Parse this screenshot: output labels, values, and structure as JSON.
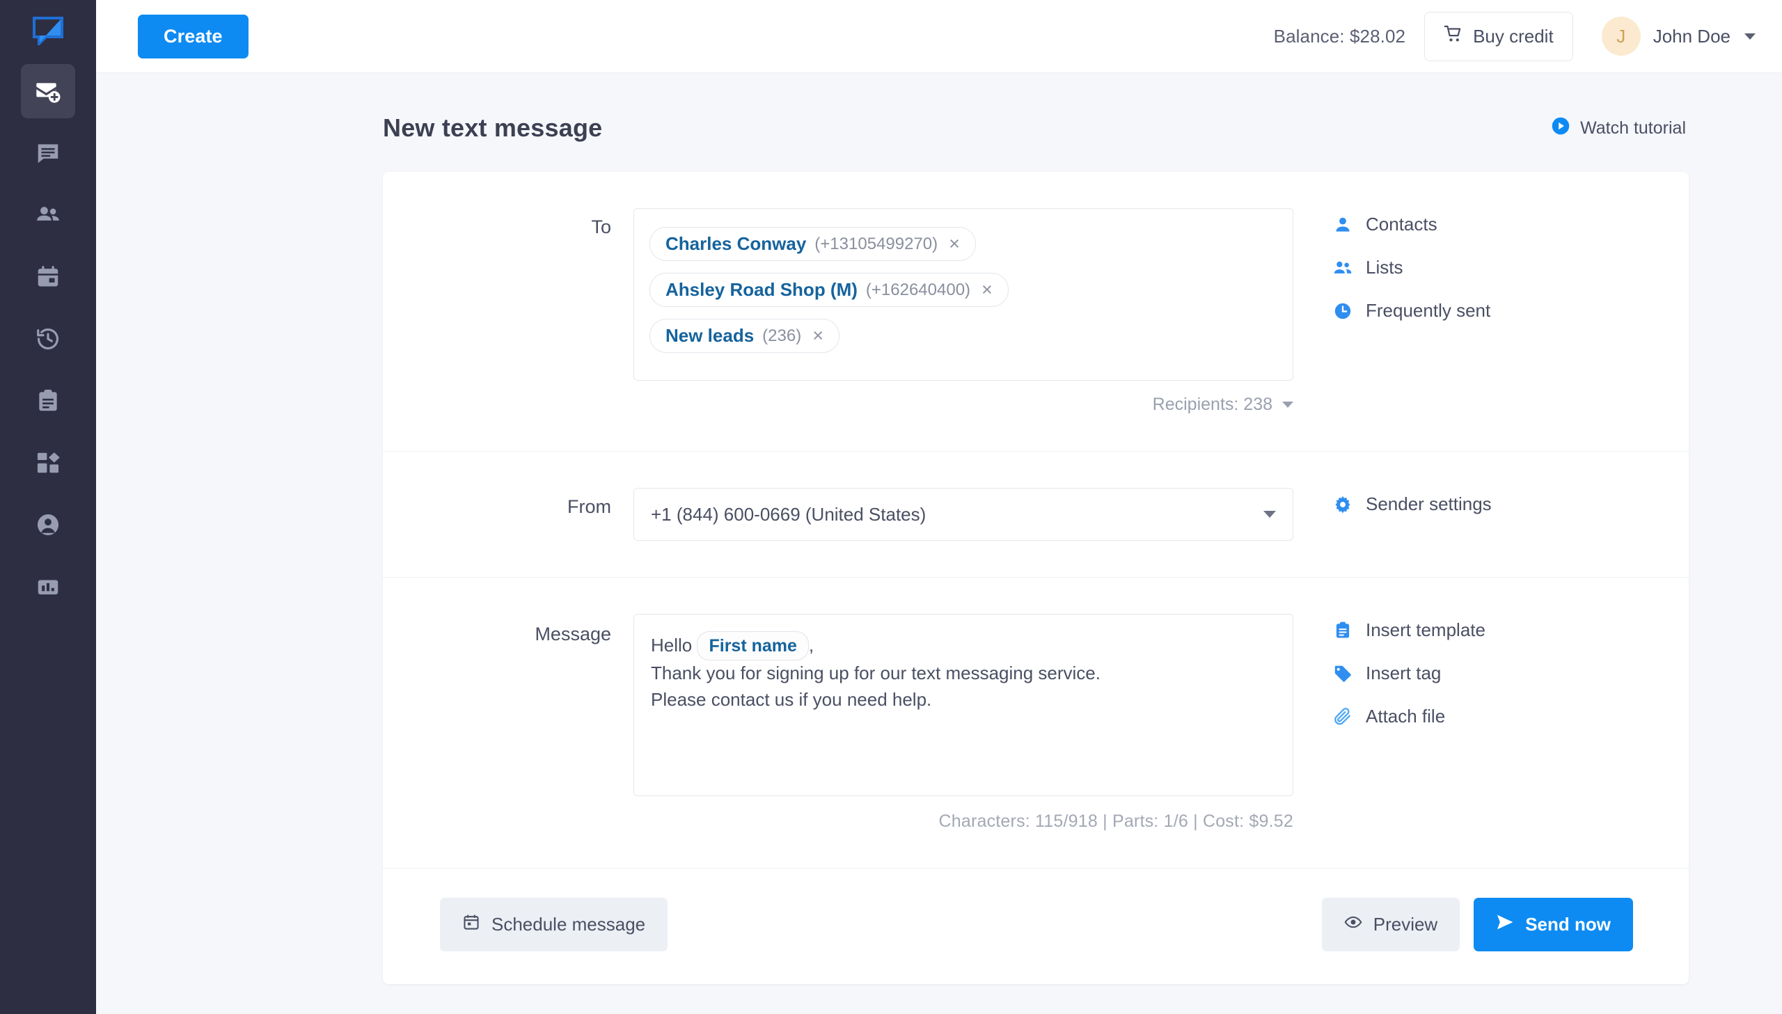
{
  "brand": {
    "logo_name": "speech-bubble-logo",
    "accent": "#0d8bf2",
    "sidebar_bg": "#2e2e42"
  },
  "sidebar": {
    "items": [
      {
        "icon": "new-message-icon",
        "label": "New message",
        "active": true
      },
      {
        "icon": "chat-icon",
        "label": "Chat",
        "active": false
      },
      {
        "icon": "contacts-icon",
        "label": "Contacts",
        "active": false
      },
      {
        "icon": "calendar-icon",
        "label": "Calendar",
        "active": false
      },
      {
        "icon": "history-icon",
        "label": "History",
        "active": false
      },
      {
        "icon": "clipboard-icon",
        "label": "Templates",
        "active": false
      },
      {
        "icon": "apps-icon",
        "label": "Apps",
        "active": false
      },
      {
        "icon": "account-icon",
        "label": "Account",
        "active": false
      },
      {
        "icon": "reports-icon",
        "label": "Reports",
        "active": false
      }
    ]
  },
  "topbar": {
    "create_label": "Create",
    "balance_label": "Balance: $28.02",
    "buy_credit_label": "Buy credit",
    "cart_icon": "shopping-cart-icon",
    "avatar_initial": "J",
    "user_name": "John Doe",
    "avatar_bg": "#fbeacf",
    "avatar_fg": "#cfa156"
  },
  "page": {
    "title": "New text message",
    "watch_tutorial_label": "Watch tutorial",
    "watch_tutorial_icon": "play-circle-icon"
  },
  "to_row": {
    "label": "To",
    "chips": [
      {
        "name": "Charles Conway",
        "meta": "(+13105499270)",
        "remove": "×"
      },
      {
        "name": "Ahsley Road Shop (M)",
        "meta": "(+162640400)",
        "remove": "×"
      },
      {
        "name": "New leads",
        "meta": "(236)",
        "remove": "×"
      }
    ],
    "recipients_label": "Recipients: 238",
    "side_links": [
      {
        "icon": "person-icon",
        "label": "Contacts"
      },
      {
        "icon": "people-icon",
        "label": "Lists"
      },
      {
        "icon": "clock-icon",
        "label": "Frequently sent"
      }
    ]
  },
  "from_row": {
    "label": "From",
    "value": "+1 (844) 600-0669 (United States)",
    "side_links": [
      {
        "icon": "gear-icon",
        "label": "Sender settings"
      }
    ]
  },
  "message_row": {
    "label": "Message",
    "greeting": "Hello",
    "merge_tag": "First name",
    "comma": ",",
    "line2": "Thank you for signing up for our text messaging service.",
    "line3": "Please contact us if you need help.",
    "counter": "Characters: 115/918  |  Parts: 1/6  |  Cost: $9.52",
    "side_links": [
      {
        "icon": "clipboard-icon",
        "label": "Insert template"
      },
      {
        "icon": "tag-icon",
        "label": "Insert tag"
      },
      {
        "icon": "paperclip-icon",
        "label": "Attach file"
      }
    ]
  },
  "footer": {
    "schedule_label": "Schedule message",
    "schedule_icon": "calendar-icon",
    "preview_label": "Preview",
    "preview_icon": "eye-icon",
    "send_label": "Send now",
    "send_icon": "send-icon"
  }
}
